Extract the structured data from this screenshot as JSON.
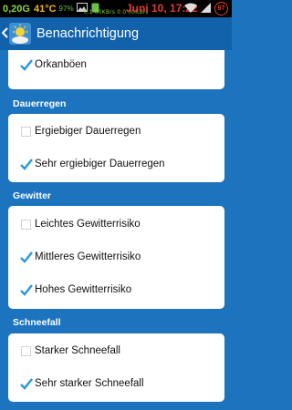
{
  "status_bar": {
    "data_rate": "0,20G",
    "temperature": "41°C",
    "battery_small": "97%",
    "speed_text": "0.1 00KB/s  0.0 00KB/s",
    "date_time": "Juni 10, 17:22",
    "battery_badge": "97",
    "icons": [
      "image-icon",
      "phone-icon",
      "wifi-icon",
      "signal-icon",
      "battery-icon"
    ]
  },
  "action_bar": {
    "title": "Benachrichtigung",
    "back_icon": "chevron-left-icon",
    "app_icon": "sun-cloud-icon"
  },
  "sections": [
    {
      "header": "",
      "items": [
        {
          "label": "Orkanböen",
          "checked": true
        }
      ]
    },
    {
      "header": "Dauerregen",
      "items": [
        {
          "label": "Ergiebiger Dauerregen",
          "checked": false
        },
        {
          "label": "Sehr ergiebiger Dauerregen",
          "checked": true
        }
      ]
    },
    {
      "header": "Gewitter",
      "items": [
        {
          "label": "Leichtes Gewitterrisiko",
          "checked": false
        },
        {
          "label": "Mittleres Gewitterrisiko",
          "checked": true
        },
        {
          "label": "Hohes Gewitterrisiko",
          "checked": true
        }
      ]
    },
    {
      "header": "Schneefall",
      "items": [
        {
          "label": "Starker Schneefall",
          "checked": false
        },
        {
          "label": "Sehr starker Schneefall",
          "checked": true
        }
      ]
    }
  ],
  "colors": {
    "background": "#1c73be",
    "action_bar": "#1262ab",
    "check": "#2c9ad8",
    "date_red": "#e33b2f"
  }
}
